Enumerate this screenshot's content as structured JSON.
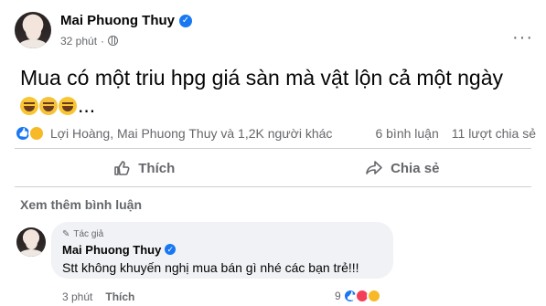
{
  "post": {
    "author": "Mai Phuong Thuy",
    "time": "32 phút",
    "dot": "·",
    "text": "Mua có một triu hpg giá sàn mà vật lộn cả một ngày",
    "ellipsis": "...",
    "more": "···"
  },
  "reactions": {
    "names": "Lợi Hoàng, Mai Phuong Thuy và 1,2K người khác",
    "comments": "6 bình luận",
    "shares": "11 lượt chia sẻ"
  },
  "actions": {
    "like": "Thích",
    "share": "Chia sẻ"
  },
  "comments": {
    "more_label": "Xem thêm bình luận",
    "items": [
      {
        "badge": "Tác giả",
        "author": "Mai Phuong Thuy",
        "text": "Stt không khuyến nghị mua bán gì nhé các bạn trẻ!!!",
        "time": "3 phút",
        "like": "Thích",
        "reaction_count": "9"
      }
    ]
  },
  "colors": {
    "accent": "#1877f2",
    "muted": "#65676b",
    "bubble": "#f0f2f5"
  }
}
